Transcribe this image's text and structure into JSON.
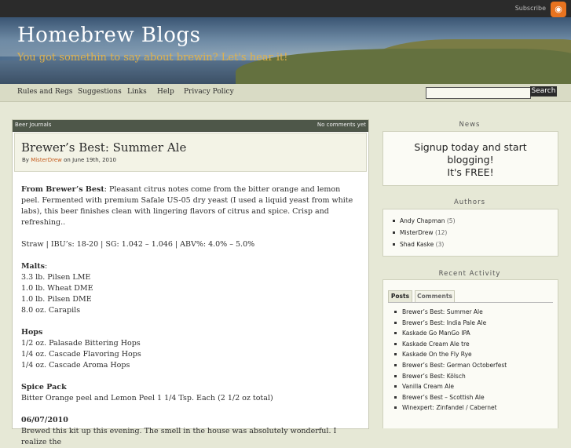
{
  "topbar": {
    "subscribe_label": "Subscribe",
    "rss_glyph": "◉"
  },
  "header": {
    "title": "Homebrew Blogs",
    "tagline": "You got somethin to say about brewin? Let's hear it!"
  },
  "nav": {
    "items": [
      "Rules and Regs",
      "Suggestions",
      "Links",
      "Help",
      "Privacy Policy"
    ],
    "search_placeholder": "",
    "search_button": "Search"
  },
  "post": {
    "category": "Beer Journals",
    "comments": "No comments yet",
    "title": "Brewer’s Best: Summer Ale",
    "by": "By",
    "author": "MisterDrew",
    "date_text": "on June 19th, 2010",
    "intro_bold": "From Brewer’s Best",
    "intro_text": ": Pleasant citrus notes come from the bitter orange and lemon peel. Fermented with premium Safale US-05 dry yeast (I used a liquid yeast from white labs), this beer finishes clean with lingering flavors of citrus and spice. Crisp and refreshing..",
    "specs": "Straw | IBU’s: 18-20 | SG: 1.042 – 1.046 | ABV%: 4.0% – 5.0%",
    "malts_heading": "Malts",
    "malts_colon": ":",
    "malts": [
      "3.3 lb. Pilsen LME",
      "1.0 lb. Wheat DME",
      "1.0 lb. Pilsen DME",
      "8.0 oz. Carapils"
    ],
    "hops_heading": "Hops",
    "hops": [
      "1/2 oz. Palasade Bittering Hops",
      "1/4 oz. Cascade Flavoring Hops",
      "1/4 oz. Cascade Aroma Hops"
    ],
    "spice_heading": "Spice Pack",
    "spice": "Bitter Orange peel and Lemon Peel 1 1/4 Tsp. Each (2 1/2 oz total)",
    "journal_date": "06/07/2010",
    "journal_text": "Brewed this kit up this evening. The smell in the house was absolutely wonderful. I realize the"
  },
  "sidebar": {
    "news_heading": "News",
    "news_line1": "Signup today and start",
    "news_line2": "blogging!",
    "news_line3": "It's FREE!",
    "authors_heading": "Authors",
    "authors": [
      {
        "name": "Andy Chapman",
        "count": "(5)"
      },
      {
        "name": "MisterDrew",
        "count": "(12)"
      },
      {
        "name": "Shad Kaske",
        "count": "(3)"
      }
    ],
    "recent_heading": "Recent Activity",
    "tab_posts": "Posts",
    "tab_comments": "Comments",
    "recent": [
      "Brewer’s Best: Summer Ale",
      "Brewer’s Best: India Pale Ale",
      "Kaskade Go ManGo IPA",
      "Kaskade Cream Ale tre",
      "Kaskade On the Fly Rye",
      "Brewer’s Best: German Octoberfest",
      "Brewer’s Best: Kölsch",
      "Vanilla Cream Ale",
      "Brewer’s Best – Scottish Ale",
      "Winexpert: Zinfandel / Cabernet"
    ]
  }
}
